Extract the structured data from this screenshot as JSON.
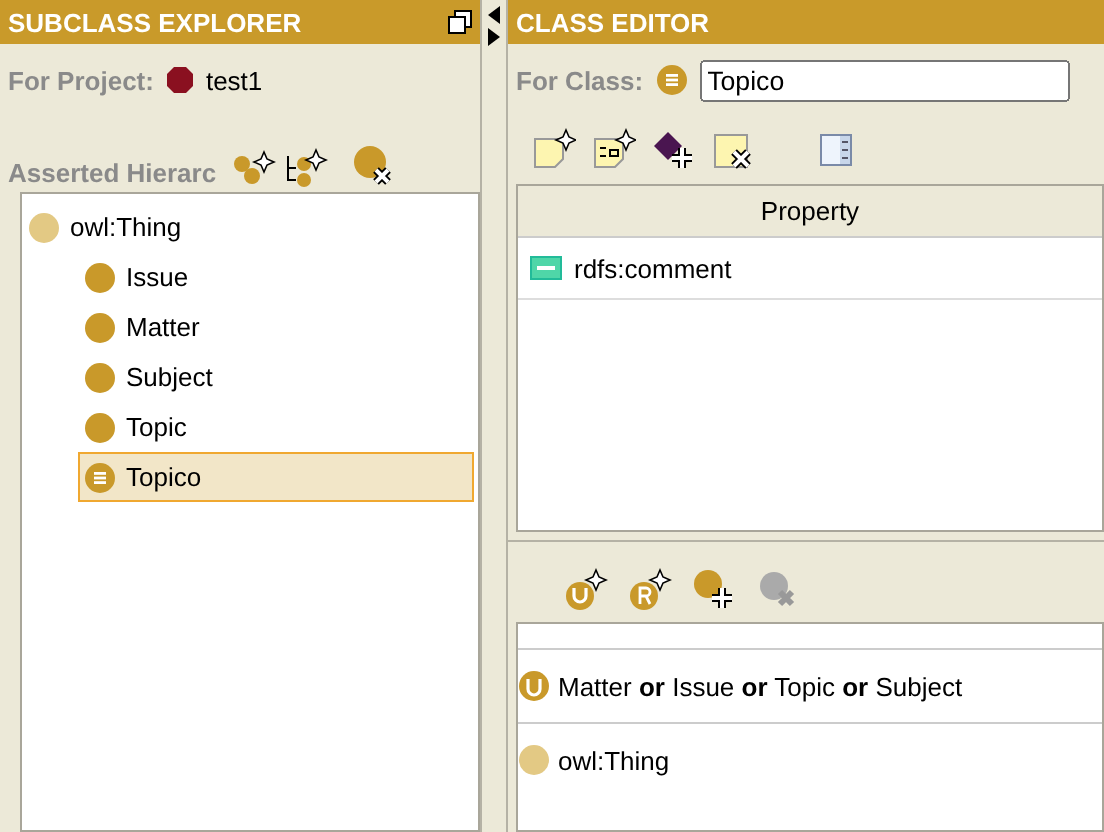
{
  "subclass_explorer": {
    "title": "SUBCLASS EXPLORER",
    "project_label": "For Project:",
    "project_name": "test1",
    "hierarchy_label": "Asserted Hierarc",
    "tree": [
      {
        "label": "owl:Thing",
        "kind": "thing",
        "selected": false,
        "children": [
          {
            "label": "Issue",
            "kind": "primitive",
            "selected": false
          },
          {
            "label": "Matter",
            "kind": "primitive",
            "selected": false
          },
          {
            "label": "Subject",
            "kind": "primitive",
            "selected": false
          },
          {
            "label": "Topic",
            "kind": "primitive",
            "selected": false
          },
          {
            "label": "Topico",
            "kind": "defined",
            "selected": true
          }
        ]
      }
    ]
  },
  "class_editor": {
    "title": "CLASS EDITOR",
    "class_label": "For Class:",
    "class_value": "Topico",
    "table": {
      "columns": [
        "Property"
      ],
      "rows": [
        {
          "property": "rdfs:comment"
        }
      ]
    },
    "expressions": [
      {
        "kind": "union",
        "text": "Matter **or** Issue **or** Topic **or** Subject"
      },
      {
        "kind": "thing",
        "text": "owl:Thing"
      }
    ]
  }
}
